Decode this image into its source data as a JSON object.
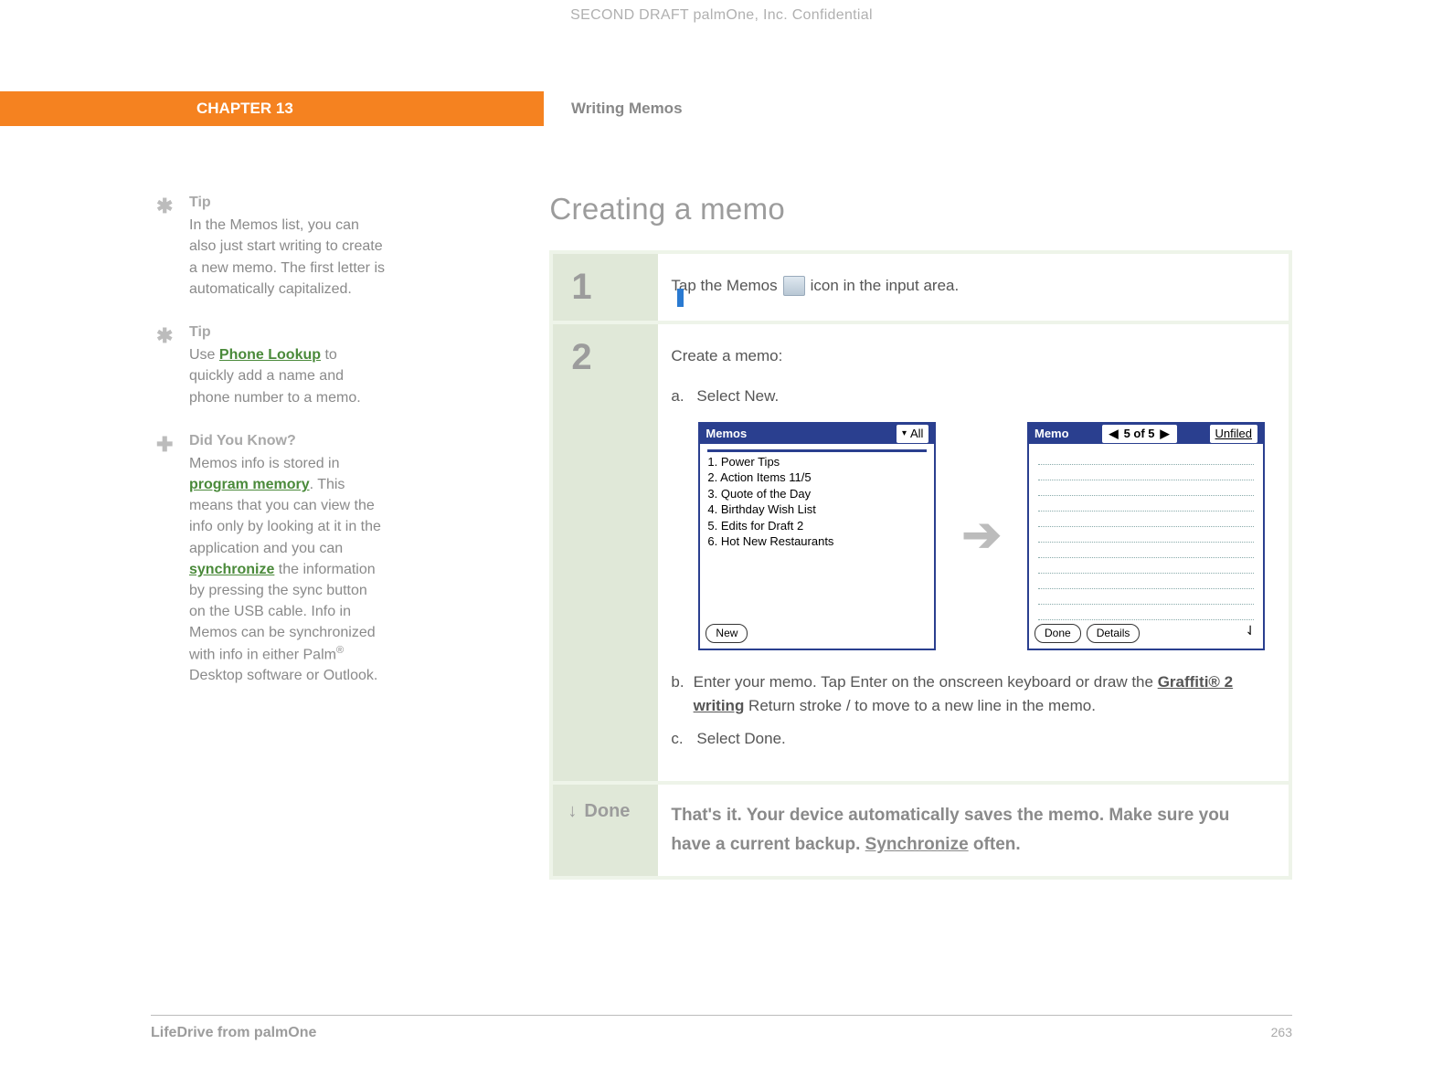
{
  "watermark": "SECOND DRAFT palmOne, Inc.  Confidential",
  "chapter": "CHAPTER 13",
  "chapter_title": "Writing Memos",
  "section_title": "Creating a memo",
  "sidebar": {
    "tip1": {
      "label": "Tip",
      "text": "In the Memos list, you can also just start writing to create a new memo. The first letter is automatically capitalized."
    },
    "tip2": {
      "label": "Tip",
      "pre": "Use ",
      "link": "Phone Lookup",
      "post": " to quickly add a name and phone number to a memo."
    },
    "dyk": {
      "label": "Did You Know?",
      "p1a": "Memos info is stored in ",
      "link1": "program memory",
      "p1b": ". This means that you can view the info only by looking at it in the application and you can ",
      "link2": "synchronize",
      "p1c": " the information by pressing the sync button on the USB cable. Info in Memos can be synchronized with info in either Palm",
      "reg": "®",
      "p1d": " Desktop software or Outlook."
    }
  },
  "steps": {
    "s1": {
      "num": "1",
      "pre": "Tap the Memos ",
      "post": " icon in the input area."
    },
    "s2": {
      "num": "2",
      "intro": "Create a memo:",
      "a_label": "a.",
      "a_text": "Select New.",
      "b_label": "b.",
      "b_pre": "Enter your memo. Tap Enter on the onscreen keyboard or draw the ",
      "b_link": "Graffiti® 2 writing",
      "b_post": " Return stroke ",
      "b_end": " to move to a new line in the memo.",
      "c_label": "c.",
      "c_text": "Select Done."
    },
    "done": {
      "label": "Done",
      "pre": "That's it. Your device automatically saves the memo. Make sure you have a current backup. ",
      "link": "Synchronize",
      "post": " often."
    }
  },
  "palm1": {
    "title": "Memos",
    "category_arrow": "▾",
    "category": "All",
    "items": [
      "1.  Power Tips",
      "2.  Action Items 11/5",
      "3.  Quote of the Day",
      "4.  Birthday Wish List",
      "5.  Edits for Draft 2",
      "6.  Hot New Restaurants"
    ],
    "btn_new": "New"
  },
  "palm2": {
    "title": "Memo",
    "counter": "5 of 5",
    "category": "Unfiled",
    "btn_done": "Done",
    "btn_details": "Details"
  },
  "footer": {
    "product": "LifeDrive from palmOne",
    "page": "263"
  }
}
